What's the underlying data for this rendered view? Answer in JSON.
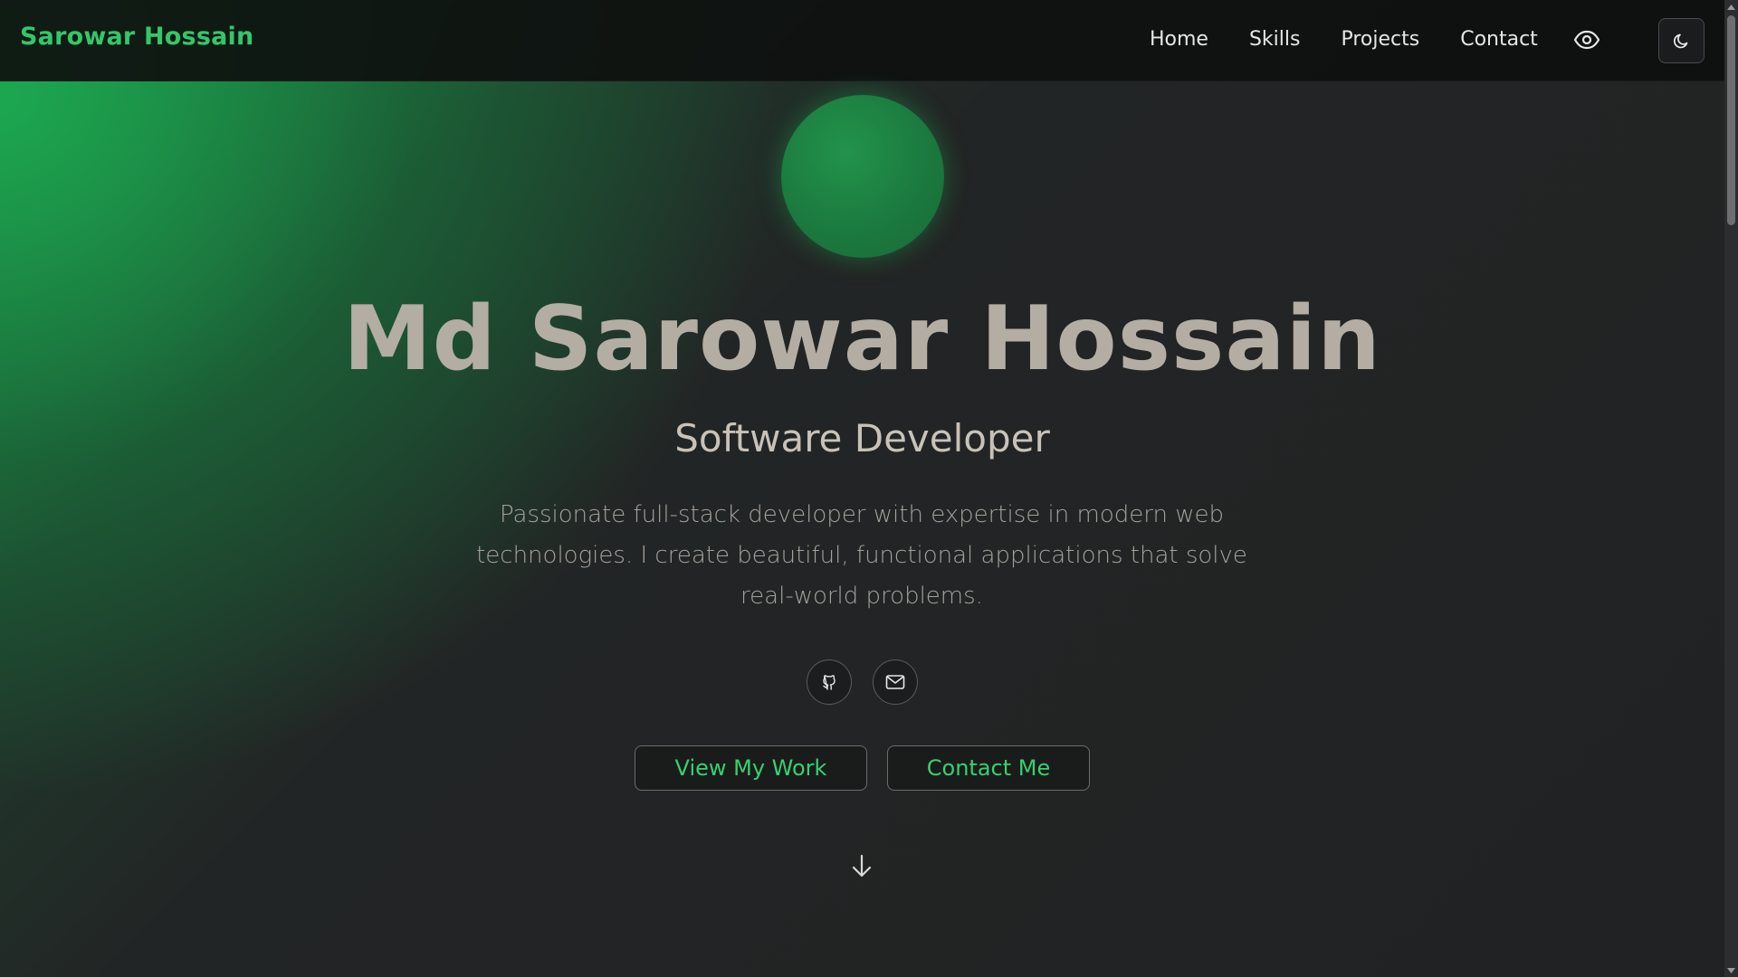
{
  "nav": {
    "brand": "Sarowar Hossain",
    "links": [
      {
        "label": "Home"
      },
      {
        "label": "Skills"
      },
      {
        "label": "Projects"
      },
      {
        "label": "Contact"
      }
    ],
    "icons": {
      "visibility": "eye-icon",
      "theme": "moon-icon"
    }
  },
  "hero": {
    "name": "Md Sarowar Hossain",
    "role": "Software Developer",
    "description": "Passionate full-stack developer with expertise in modern web technologies. I create beautiful, functional applications that solve real-world problems.",
    "social": [
      {
        "icon": "github-icon"
      },
      {
        "icon": "mail-icon"
      }
    ],
    "buttons": {
      "primary": "View My Work",
      "secondary": "Contact Me"
    },
    "scroll_icon": "arrow-down-icon"
  },
  "colors": {
    "accent": "#34c76a",
    "background": "#212224",
    "name_text": "#b4ada3"
  }
}
